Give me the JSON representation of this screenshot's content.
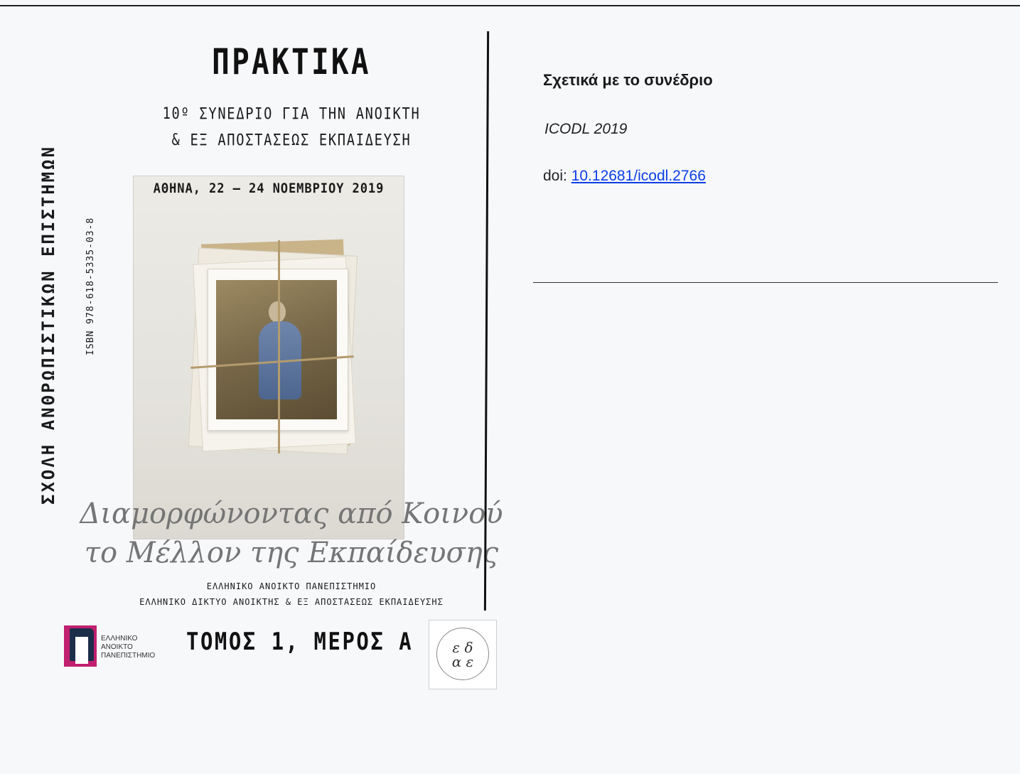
{
  "cover": {
    "title": "ΠΡΑΚΤΙΚΑ",
    "conference_line1": "10º ΣΥΝΕΔΡΙΟ ΓΙΑ ΤΗΝ ΑΝΟΙΚΤΗ",
    "conference_line2": "& ΕΞ ΑΠΟΣΤΑΣΕΩΣ ΕΚΠΑΙΔΕΥΣΗ",
    "school_vertical": "ΣΧΟΛΗ ΑΝΘΡΩΠΙΣΤΙΚΩΝ ΕΠΙΣΤΗΜΩΝ",
    "isbn": "ISBN 978-618-5335-03-8",
    "date_place": "ΑΘΗΝΑ, 22 – 24 ΝΟΕΜΒΡΙΟΥ 2019",
    "theme_line1": "Διαμορφώνοντας από Κοινού",
    "theme_line2": "το Μέλλον της Εκπαίδευσης",
    "publisher_line1": "ΕΛΛΗΝΙΚΟ ΑΝΟΙΚΤΟ ΠΑΝΕΠΙΣΤΗΜΙΟ",
    "publisher_line2": "ΕΛΛΗΝΙΚΟ ΔΙΚΤΥΟ ΑΝΟΙΚΤΗΣ & ΕΞ ΑΠΟΣΤΑΣΕΩΣ ΕΚΠΑΙΔΕΥΣΗΣ",
    "volume": "ΤΟΜΟΣ 1, ΜΕΡΟΣ Α",
    "eap_logo_lines": [
      "ΕΛΛΗΝΙΚΟ",
      "ΑΝΟΙΚΤΟ",
      "ΠΑΝΕΠΙΣΤΗΜΙΟ"
    ],
    "edae_logo_text": "ε δ α ε",
    "eap_colors": {
      "magenta": "#c0206f",
      "navy": "#1d2e4a"
    }
  },
  "info": {
    "heading": "Σχετικά με το συνέδριο",
    "conference": "ICODL 2019",
    "doi_label": "doi:",
    "doi_value": "10.12681/icodl.2766",
    "link_color": "#0b3ee6"
  }
}
